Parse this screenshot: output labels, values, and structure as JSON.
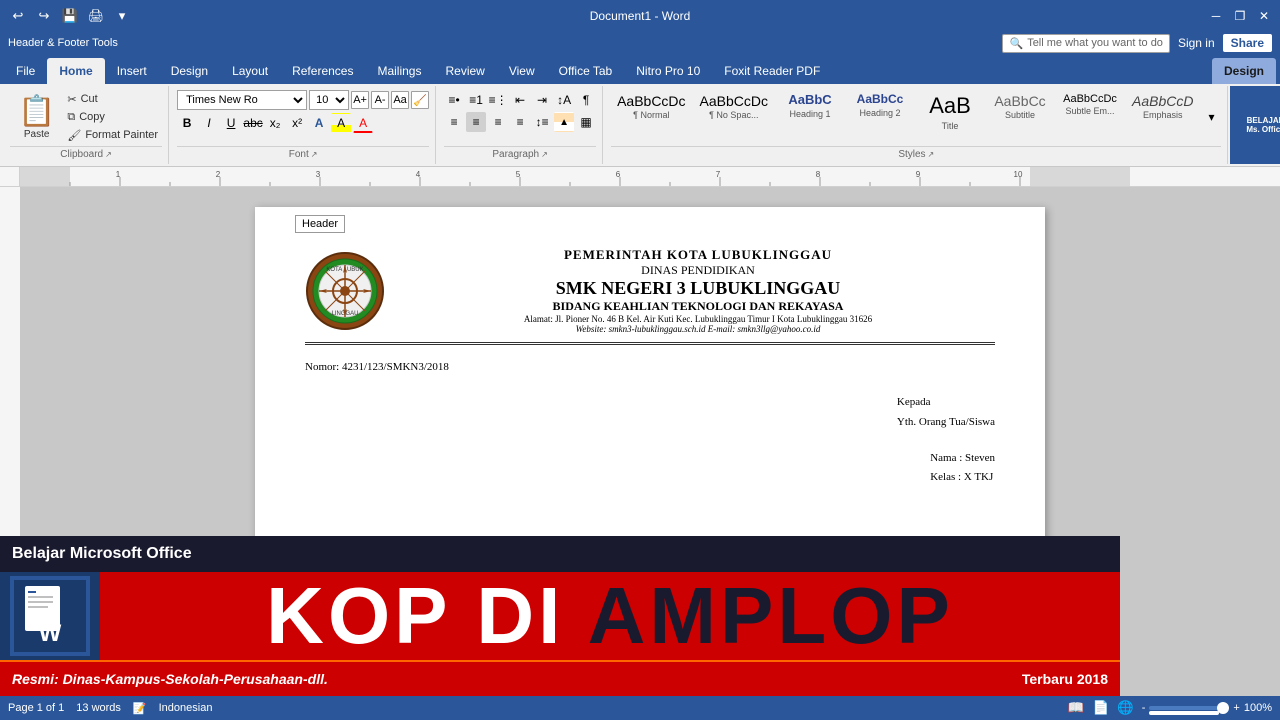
{
  "titleBar": {
    "title": "Document1 - Word",
    "qatButtons": [
      "undo",
      "redo",
      "customize"
    ],
    "windowButtons": [
      "minimize",
      "restore",
      "close"
    ]
  },
  "hfToolsBar": {
    "title": "Header & Footer Tools",
    "activeTab": "Design"
  },
  "ribbonTabs": {
    "items": [
      "File",
      "Home",
      "Insert",
      "Design",
      "Layout",
      "References",
      "Mailings",
      "Review",
      "View",
      "Office Tab",
      "Nitro Pro 10",
      "Foxit Reader PDF"
    ],
    "activeIndex": 1,
    "hfDesignActive": true,
    "hfDesignLabel": "Design"
  },
  "clipboard": {
    "paste": "Paste",
    "cut": "Cut",
    "copy": "Copy",
    "formatPainter": "Format Painter",
    "groupLabel": "Clipboard"
  },
  "font": {
    "name": "Times New Ro",
    "size": "10",
    "groupLabel": "Font",
    "bold": "B",
    "italic": "I",
    "underline": "U",
    "strikethrough": "abc",
    "subscript": "x₂",
    "superscript": "x²"
  },
  "paragraph": {
    "groupLabel": "Paragraph"
  },
  "styles": {
    "groupLabel": "Styles",
    "items": [
      {
        "preview": "AaBbCcDc",
        "label": "¶ Normal",
        "color": "#000"
      },
      {
        "preview": "AaBbCcDc",
        "label": "¶ No Spac...",
        "color": "#000"
      },
      {
        "preview": "AaBbC",
        "label": "Heading 1",
        "color": "#2b4590"
      },
      {
        "preview": "AaBbCc",
        "label": "Heading 2",
        "color": "#2b4590"
      },
      {
        "preview": "AaB",
        "label": "Title",
        "color": "#000",
        "large": true
      },
      {
        "preview": "AaBbCc",
        "label": "Subtitle",
        "color": "#666"
      },
      {
        "preview": "AaBbCcDc",
        "label": "Subtle Em...",
        "color": "#666"
      },
      {
        "preview": "AaBbCcD",
        "label": "Emphasis",
        "color": "#666",
        "italic": true
      }
    ]
  },
  "search": {
    "placeholder": "Tell me what you want to do",
    "icon": "search-icon"
  },
  "signIn": {
    "label": "Sign in"
  },
  "share": {
    "label": "Share"
  },
  "document": {
    "header": {
      "label": "Header",
      "schoolNameMain": "PEMERINTAH KOTA LUBUKLINGGAU",
      "schoolDept": "DINAS PENDIDIKAN",
      "schoolNameBig": "SMK NEGERI 3 LUBUKLINGGAU",
      "schoolBidang": "BIDANG KEAHLIAN TEKNOLOGI DAN REKAYASA",
      "schoolAddress": "Alamat: Jl. Pioner No. 46 B Kel. Air Kuti Kec. Lubuklinggau Timur I Kota Lubuklinggau 31626",
      "schoolWebsite": "Website: smkn3-lubuklinggau.sch.id   E-mail: smkn3llg@yahoo.co.id"
    },
    "body": {
      "nomor": "Nomor: 4231/123/SMKN3/2018",
      "kepada": "Kepada",
      "kepadaName": "Yth. Orang Tua/Siswa",
      "namaLabel": "Nama",
      "namaValue": ": Steven",
      "kelasLabel": "Kelas",
      "kelasValue": ": X TKJ"
    }
  },
  "promoBanner": {
    "topText": "Belajar Microsoft Office",
    "mainText1": "KOP DI ",
    "mainTextDark": "AMPLOP",
    "bottomLeft": "Resmi: Dinas-Kampus-Sekolah-Perusahaan-dll.",
    "bottomRight": "Terbaru 2018"
  },
  "statusBar": {
    "page": "Page 1 of 1",
    "words": "13 words",
    "language": "Indonesian",
    "zoom": "100%"
  }
}
